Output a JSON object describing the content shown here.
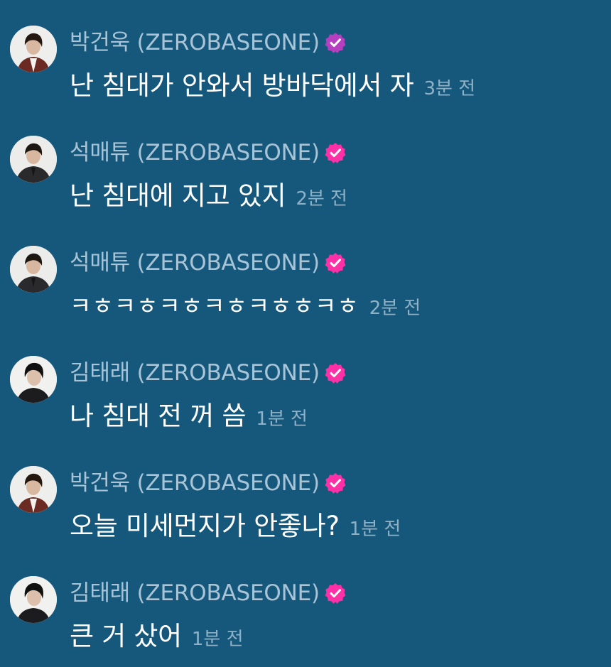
{
  "colors": {
    "background": "#15587c",
    "name_text": "#a9c4d6",
    "message_text": "#ffffff",
    "time_text": "#8fb0c5",
    "verified_badge": "#ff2fa6"
  },
  "messages": [
    {
      "sender": "박건욱 (ZEROBASEONE)",
      "text": "난 침대가 안와서 방바닥에서 자",
      "time": "3분 전",
      "avatar_icon": "avatar-photo-icon",
      "badge_icon": "verified-badge-icon"
    },
    {
      "sender": "석매튜 (ZEROBASEONE)",
      "text": "난 침대에 지고 있지",
      "time": "2분 전",
      "avatar_icon": "avatar-photo-icon",
      "badge_icon": "verified-badge-icon"
    },
    {
      "sender": "석매튜 (ZEROBASEONE)",
      "text": "ㅋㅎㅋㅎㅋㅎㅋㅎㅋㅎㅎㅋㅎ",
      "time": "2분 전",
      "avatar_icon": "avatar-photo-icon",
      "badge_icon": "verified-badge-icon"
    },
    {
      "sender": "김태래 (ZEROBASEONE)",
      "text": "나 침대 전 꺼 씀",
      "time": "1분 전",
      "avatar_icon": "avatar-photo-icon",
      "badge_icon": "verified-badge-icon"
    },
    {
      "sender": "박건욱 (ZEROBASEONE)",
      "text": "오늘 미세먼지가 안좋나?",
      "time": "1분 전",
      "avatar_icon": "avatar-photo-icon",
      "badge_icon": "verified-badge-icon"
    },
    {
      "sender": "김태래 (ZEROBASEONE)",
      "text": "큰 거 샀어",
      "time": "1분 전",
      "avatar_icon": "avatar-photo-icon",
      "badge_icon": "verified-badge-icon"
    }
  ]
}
